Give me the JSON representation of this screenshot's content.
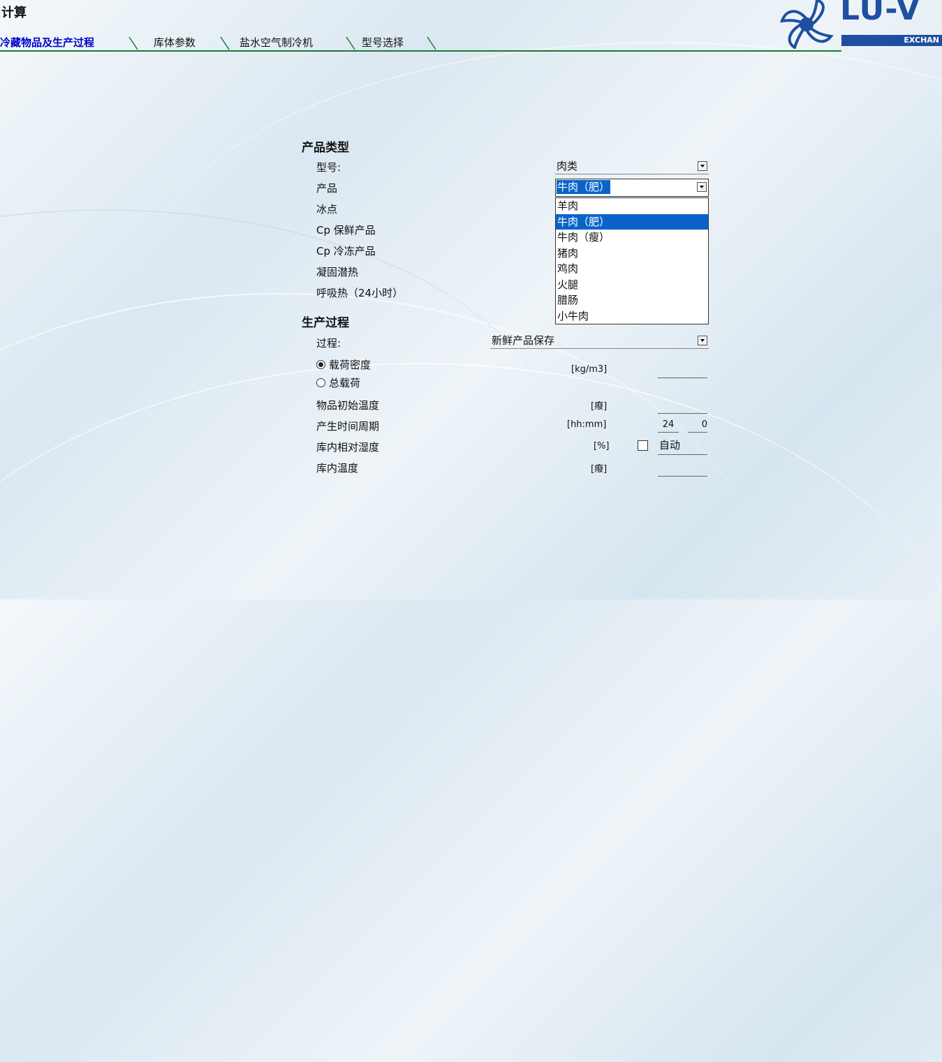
{
  "window": {
    "title": "计算"
  },
  "logo": {
    "brand": "LU-V",
    "subtitle": "EXCHAN"
  },
  "tabs": [
    {
      "label": "冷藏物品及生产过程",
      "active": true
    },
    {
      "label": "库体参数",
      "active": false
    },
    {
      "label": "盐水空气制冷机",
      "active": false
    },
    {
      "label": "型号选择",
      "active": false
    }
  ],
  "product": {
    "section_title": "产品类型",
    "labels": {
      "model": "型号:",
      "product": "产品",
      "freezing_point": "冰点",
      "cp_fresh": "Cp 保鲜产品",
      "cp_frozen": "Cp 冷冻产品",
      "latent_heat": "凝固潜热",
      "respiration": "呼吸热（24小时）"
    },
    "model_value": "肉类",
    "product_value": "牛肉（肥）",
    "dropdown_options": [
      "羊肉",
      "牛肉（肥）",
      "牛肉（瘦）",
      "猪肉",
      "鸡肉",
      "火腿",
      "腊肠",
      "小牛肉"
    ],
    "dropdown_highlighted_index": 1
  },
  "process": {
    "section_title": "生产过程",
    "labels": {
      "process": "过程:",
      "load_density": "载荷密度",
      "total_load": "总载荷",
      "initial_temp": "物品初始温度",
      "period": "产生时间周期",
      "humidity": "库内相对湿度",
      "room_temp": "库内温度"
    },
    "process_value": "新鲜产品保存",
    "radio_selected": "load_density",
    "units": {
      "density": "[kg/m3]",
      "temp": "[癈]",
      "period": "[hh:mm]",
      "humidity": "[%]",
      "room_temp": "[癈]"
    },
    "period_hours": "24",
    "period_minutes": "0",
    "auto_label": "自动",
    "auto_checked": false
  }
}
